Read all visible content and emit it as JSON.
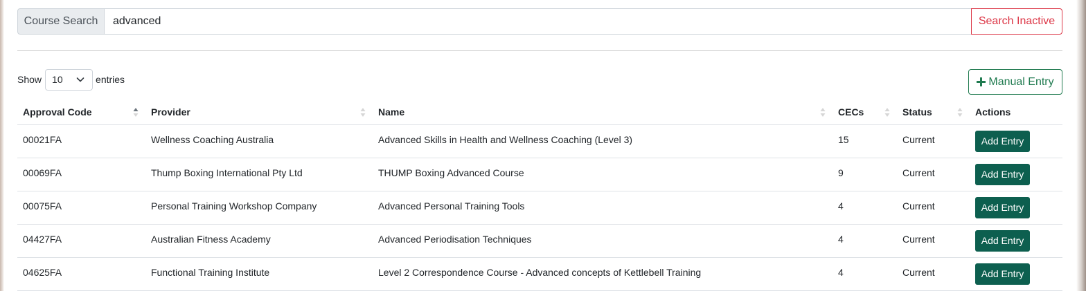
{
  "search": {
    "label": "Course Search",
    "value": "advanced",
    "inactive_button": "Search Inactive"
  },
  "length": {
    "show": "Show",
    "selected": "10",
    "entries": "entries"
  },
  "manual_entry": {
    "label": "Manual Entry",
    "icon": "plus-icon"
  },
  "columns": {
    "approval_code": "Approval Code",
    "provider": "Provider",
    "name": "Name",
    "cecs": "CECs",
    "status": "Status",
    "actions": "Actions"
  },
  "sort": {
    "column": "Approval Code",
    "direction": "ascending"
  },
  "rows": [
    {
      "code": "00021FA",
      "provider": "Wellness Coaching Australia",
      "name": "Advanced Skills in Health and Wellness Coaching (Level 3)",
      "cecs": "15",
      "status": "Current",
      "action": "Add Entry"
    },
    {
      "code": "00069FA",
      "provider": "Thump Boxing International Pty Ltd",
      "name": "THUMP Boxing Advanced Course",
      "cecs": "9",
      "status": "Current",
      "action": "Add Entry"
    },
    {
      "code": "00075FA",
      "provider": "Personal Training Workshop Company",
      "name": "Advanced Personal Training Tools",
      "cecs": "4",
      "status": "Current",
      "action": "Add Entry"
    },
    {
      "code": "04427FA",
      "provider": "Australian Fitness Academy",
      "name": "Advanced Periodisation Techniques",
      "cecs": "4",
      "status": "Current",
      "action": "Add Entry"
    },
    {
      "code": "04625FA",
      "provider": "Functional Training Institute",
      "name": "Level 2 Correspondence Course - Advanced concepts of Kettlebell Training",
      "cecs": "4",
      "status": "Current",
      "action": "Add Entry"
    }
  ],
  "colors": {
    "danger": "#dc3545",
    "success": "#1f7a4f",
    "action_button": "#0d5f4f"
  }
}
